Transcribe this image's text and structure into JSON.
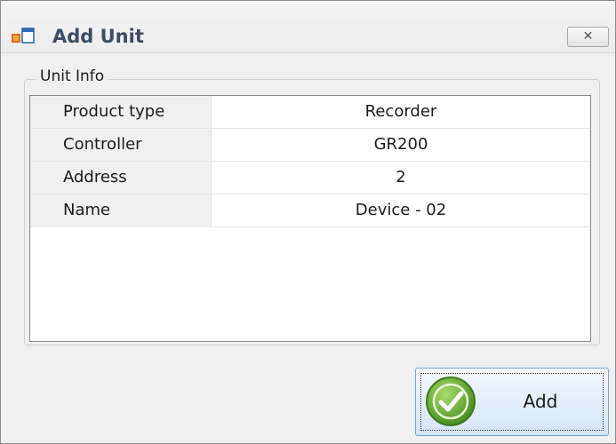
{
  "window": {
    "title": "Add Unit",
    "close_glyph": "✕"
  },
  "group": {
    "label": "Unit Info"
  },
  "properties": [
    {
      "name": "Product type",
      "value": "Recorder"
    },
    {
      "name": "Controller",
      "value": "GR200"
    },
    {
      "name": "Address",
      "value": "2"
    },
    {
      "name": "Name",
      "value": "Device - 02"
    }
  ],
  "actions": {
    "add_label": "Add"
  },
  "icons": {
    "app": "window-app-icon",
    "add": "green-check-icon",
    "close": "close-icon"
  },
  "colors": {
    "title_text": "#3c4c61",
    "button_border": "#7da2ce",
    "check_green": "#5aa02c"
  }
}
